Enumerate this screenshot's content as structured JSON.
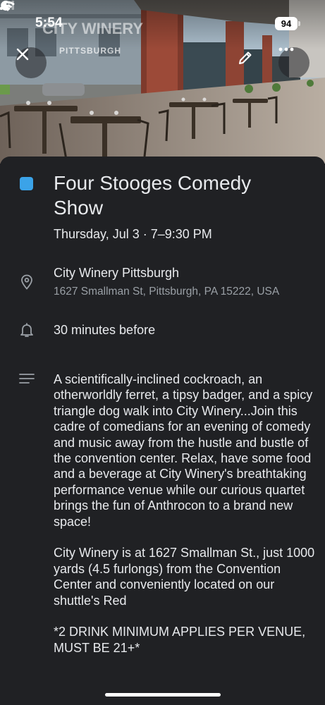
{
  "status_bar": {
    "time": "5:54",
    "battery": "94"
  },
  "hero": {
    "sign_line1": "CITY WINERY",
    "sign_line2": "PITTSBURGH"
  },
  "toolbar": {
    "close_icon": "close-icon",
    "edit_icon": "pencil-icon",
    "more_icon": "more-horizontal-icon"
  },
  "event": {
    "color": "#3ba3e8",
    "title": "Four Stooges Comedy Show",
    "datetime": "Thursday, Jul 3 · 7–9:30 PM",
    "location_name": "City Winery Pittsburgh",
    "location_address": "1627 Smallman St, Pittsburgh, PA 15222, USA",
    "reminder": "30 minutes before",
    "description": [
      "A scientifically-inclined cockroach, an otherworldly ferret, a tipsy badger, and a spicy triangle dog walk into City Winery...Join this cadre of comedians for an evening of comedy and music away from the hustle and bustle of the convention center. Relax, have some food and a beverage at City Winery's breathtaking performance venue while our curious quartet brings the fun of Anthrocon to a brand new space!",
      "City Winery is at 1627 Smallman St., just 1000 yards (4.5 furlongs) from the Convention Center and conveniently located on our shuttle's Red",
      "*2 DRINK MINIMUM APPLIES PER VENUE, MUST BE 21+*"
    ]
  }
}
